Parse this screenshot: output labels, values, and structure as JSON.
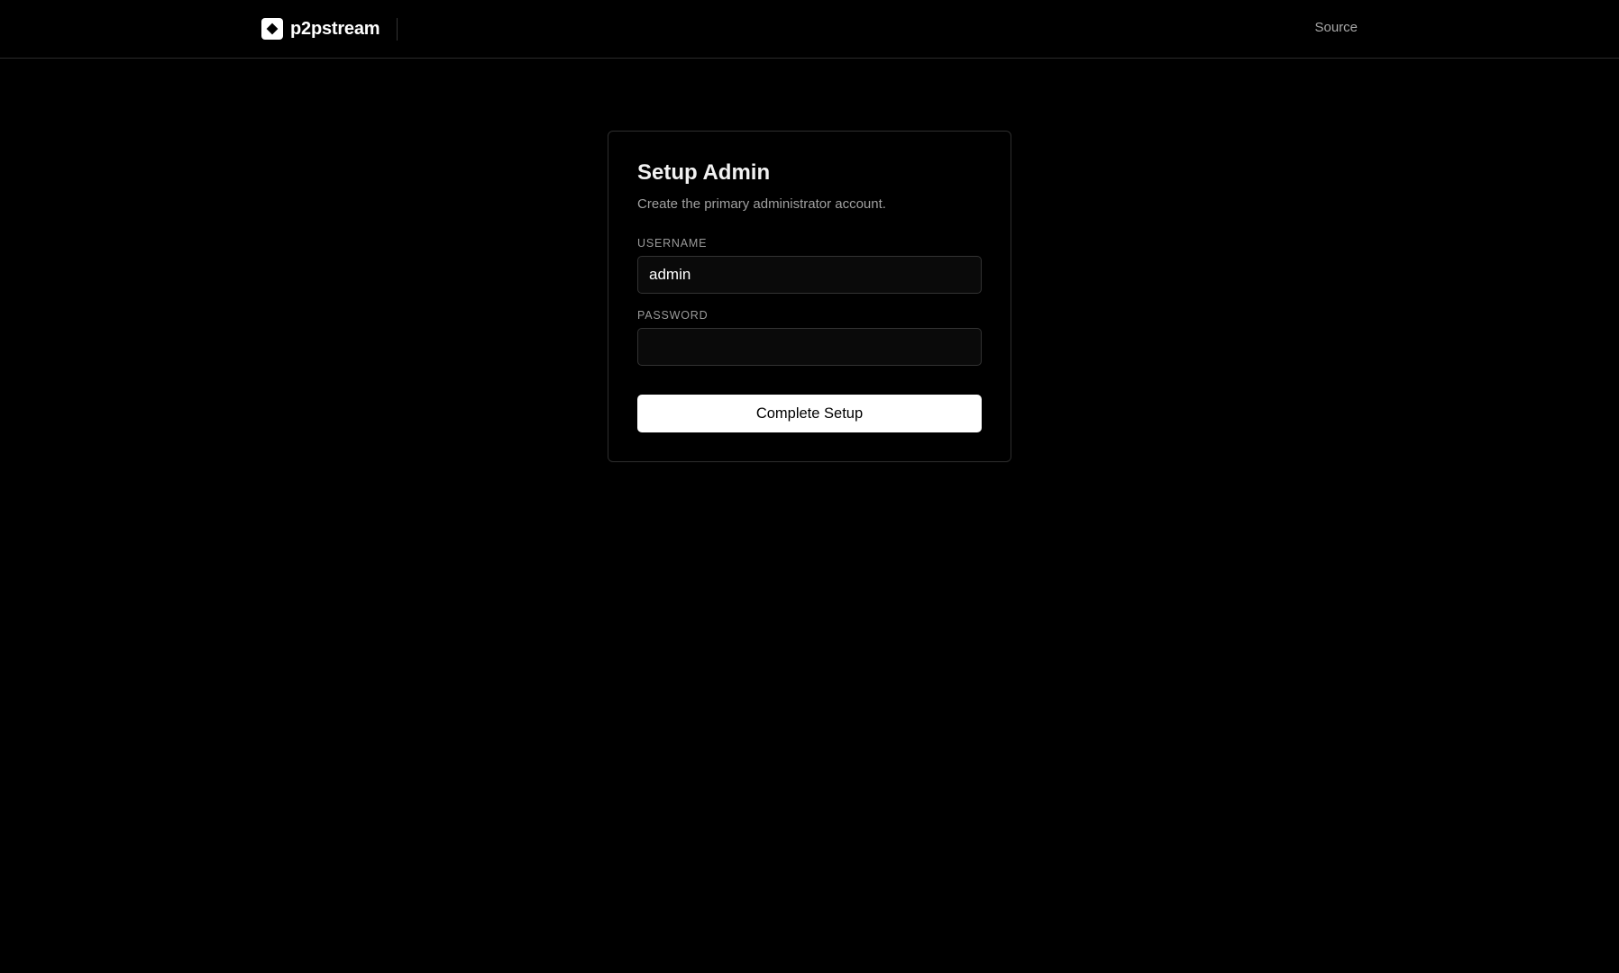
{
  "header": {
    "brand_name": "p2pstream",
    "logo_icon": "diamond-logo-icon",
    "nav_source_label": "Source"
  },
  "setup_form": {
    "title": "Setup Admin",
    "subtitle": "Create the primary administrator account.",
    "username": {
      "label": "USERNAME",
      "value": "admin"
    },
    "password": {
      "label": "PASSWORD",
      "value": ""
    },
    "submit_label": "Complete Setup"
  },
  "colors": {
    "background": "#000000",
    "text_primary": "#ffffff",
    "text_muted": "#a0a0a0",
    "border": "#2e2e2e",
    "button_bg": "#ffffff",
    "button_text": "#000000"
  }
}
